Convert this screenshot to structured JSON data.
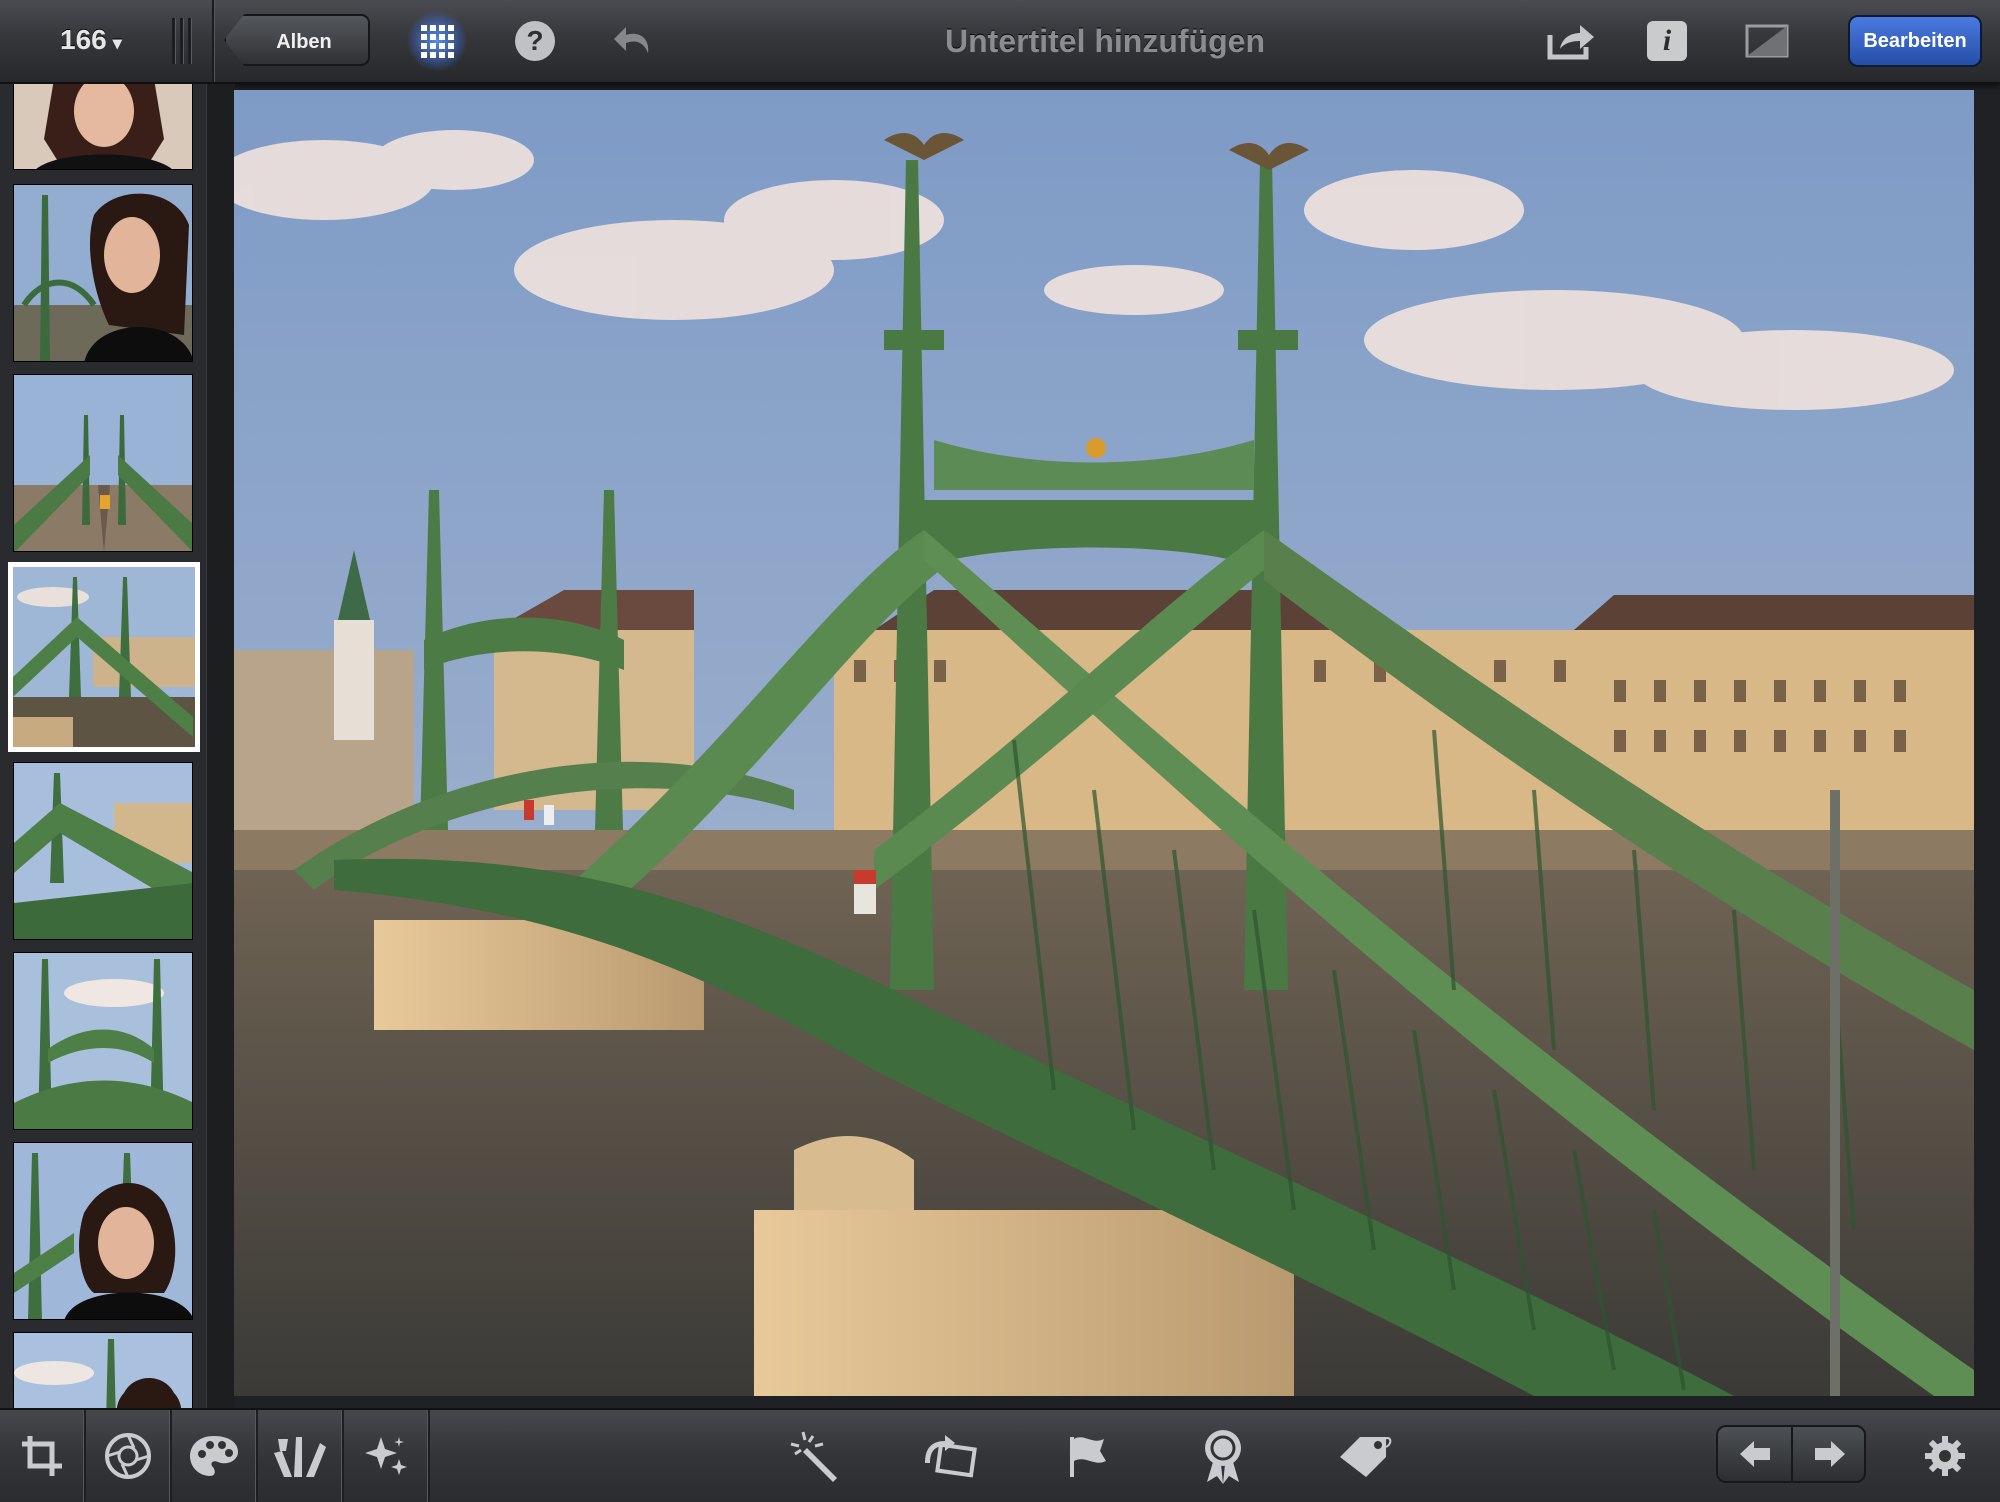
{
  "toolbar": {
    "photo_count": "166",
    "count_caret": "▾",
    "albums_label": "Alben",
    "help_label": "?",
    "subtitle_placeholder": "Untertitel hinzufügen",
    "info_label": "i",
    "edit_label": "Bearbeiten",
    "accent_color": "#3566d0"
  },
  "filmstrip": {
    "thumbnails": [
      {
        "subject": "woman-portrait-top"
      },
      {
        "subject": "woman-portrait-bridge"
      },
      {
        "subject": "bridge-deck-tram"
      },
      {
        "subject": "bridge-side-view",
        "selected": true
      },
      {
        "subject": "bridge-angle-view"
      },
      {
        "subject": "bridge-towers-sky"
      },
      {
        "subject": "woman-portrait-towers"
      },
      {
        "subject": "woman-portrait-partial"
      }
    ]
  },
  "main_photo": {
    "subject": "green-suspension-bridge-over-river"
  },
  "bottom_tools": {
    "left": [
      "crop-icon",
      "aperture-icon",
      "palette-icon",
      "brushes-icon",
      "effects-sparkle-icon"
    ],
    "center": [
      "magic-wand-icon",
      "rotate-icon",
      "flag-icon",
      "favorite-badge-icon",
      "tag-icon"
    ],
    "nav": [
      "arrow-left-icon",
      "arrow-right-icon"
    ],
    "settings": "gear-icon"
  }
}
